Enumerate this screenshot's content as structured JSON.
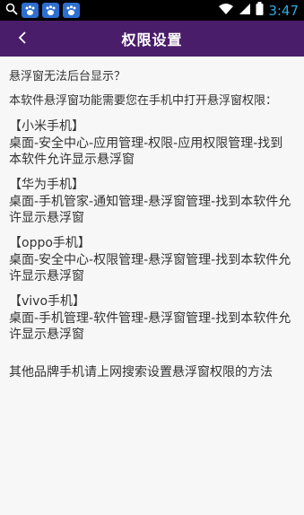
{
  "status_bar": {
    "time": "3:47",
    "icons": [
      "search-icon",
      "baidu-paw-icon",
      "baidu-paw-icon",
      "baidu-paw-icon",
      "wifi-icon",
      "signal-icon",
      "battery-icon"
    ]
  },
  "header": {
    "back_icon": "chevron-left-icon",
    "title": "权限设置"
  },
  "content": {
    "question": "悬浮窗无法后台显示？",
    "instruction": "本软件悬浮窗功能需要您在手机中打开悬浮窗权限：",
    "brands": [
      {
        "name": "【小米手机】",
        "steps": "桌面-安全中心-应用管理-权限-应用权限管理-找到本软件允许显示悬浮窗"
      },
      {
        "name": "【华为手机】",
        "steps": "桌面-手机管家-通知管理-悬浮窗管理-找到本软件允许显示悬浮窗"
      },
      {
        "name": "【oppo手机】",
        "steps": "桌面-安全中心-权限管理-悬浮窗管理-找到本软件允许显示悬浮窗"
      },
      {
        "name": "【vivo手机】",
        "steps": "桌面-手机管理-软件管理-悬浮窗管理-找到本软件允许显示悬浮窗"
      }
    ],
    "footer": "其他品牌手机请上网搜索设置悬浮窗权限的方法"
  },
  "colors": {
    "status_bar_bg": "#000000",
    "header_bg": "#4a1d6b",
    "body_bg": "#f7f7f7",
    "clock": "#2aa9e0"
  }
}
